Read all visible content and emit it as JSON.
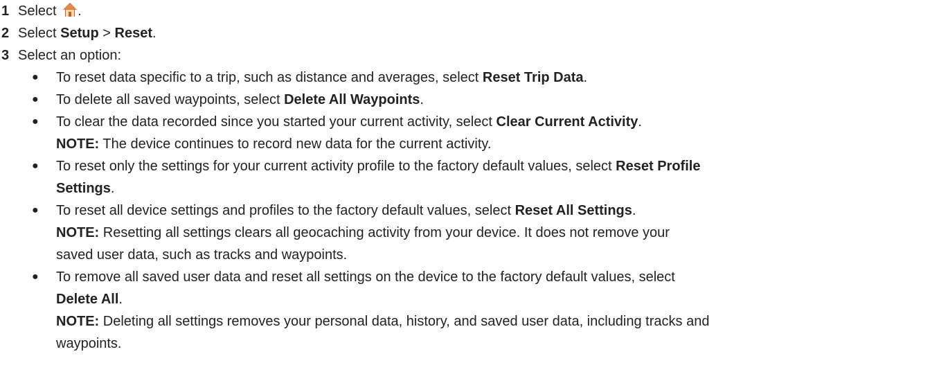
{
  "steps": [
    {
      "num": "1",
      "text": "Select",
      "suffix": "."
    },
    {
      "num": "2",
      "text": "Select",
      "b1": "Setup",
      "sep": ">",
      "b2": "Reset",
      "suffix": "."
    },
    {
      "num": "3",
      "text": "Select an option:"
    }
  ],
  "icons": {
    "home": "home-icon"
  },
  "bullets": [
    {
      "text": "To reset data specific to a trip, such as distance and averages, select",
      "bold": "Reset Trip Data",
      "end": "."
    },
    {
      "text": "To delete all saved waypoints, select",
      "bold": "Delete All Waypoints",
      "end": "."
    },
    {
      "text": "To clear the data recorded since you started your current activity, select",
      "bold": "Clear Current Activity",
      "end": ".",
      "note_label": "NOTE:",
      "note": "The device continues to record new data for the current activity."
    },
    {
      "text": "To reset only the settings for your current activity profile to the factory default values, select",
      "bold": "Reset Profile",
      "bold2": "Settings",
      "end": "."
    },
    {
      "text": "To reset all device settings and profiles to the factory default values, select",
      "bold": "Reset All Settings",
      "end": ".",
      "note_label": "NOTE:",
      "note_line1": "Resetting all settings clears all geocaching activity from your device. It does not remove your",
      "note_line2": "saved user data, such as tracks and waypoints."
    },
    {
      "text": "To remove all saved user data and reset all settings on the device to the factory default values, select",
      "bold": "Delete All",
      "end": ".",
      "note_label": "NOTE:",
      "note_line1": "Deleting all settings removes your personal data, history, and saved user data, including tracks and",
      "note_line2": "waypoints."
    }
  ],
  "bullet_char": "●"
}
